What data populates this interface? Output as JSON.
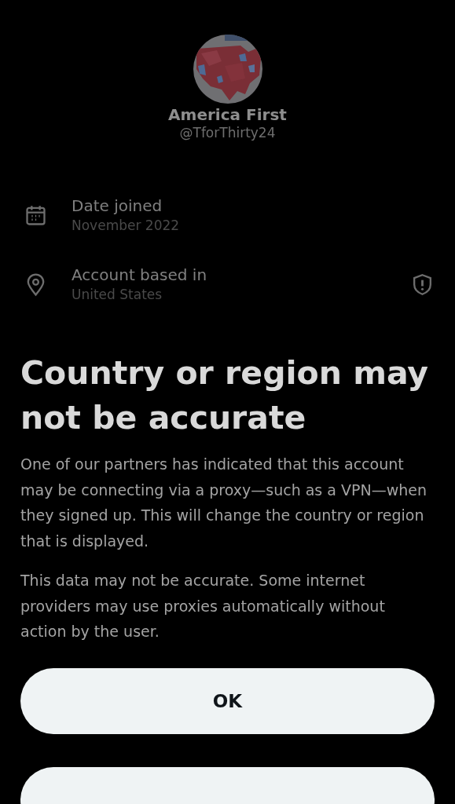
{
  "profile": {
    "name": "America First",
    "handle": "@TforThirty24"
  },
  "details": [
    {
      "kind": "date",
      "label": "Date joined",
      "value": "November 2022",
      "warning": false
    },
    {
      "kind": "location",
      "label": "Account based in",
      "value": "United States",
      "warning": true
    }
  ],
  "sheet": {
    "title": "Country or region may not be accurate",
    "paragraphs": [
      "One of our partners has indicated that this account may be connecting via a proxy—such as a VPN—when they signed up. This will change the country or region that is displayed.",
      "This data may not be accurate. Some internet providers may use proxies automatically without action by the user."
    ],
    "button": "OK"
  }
}
